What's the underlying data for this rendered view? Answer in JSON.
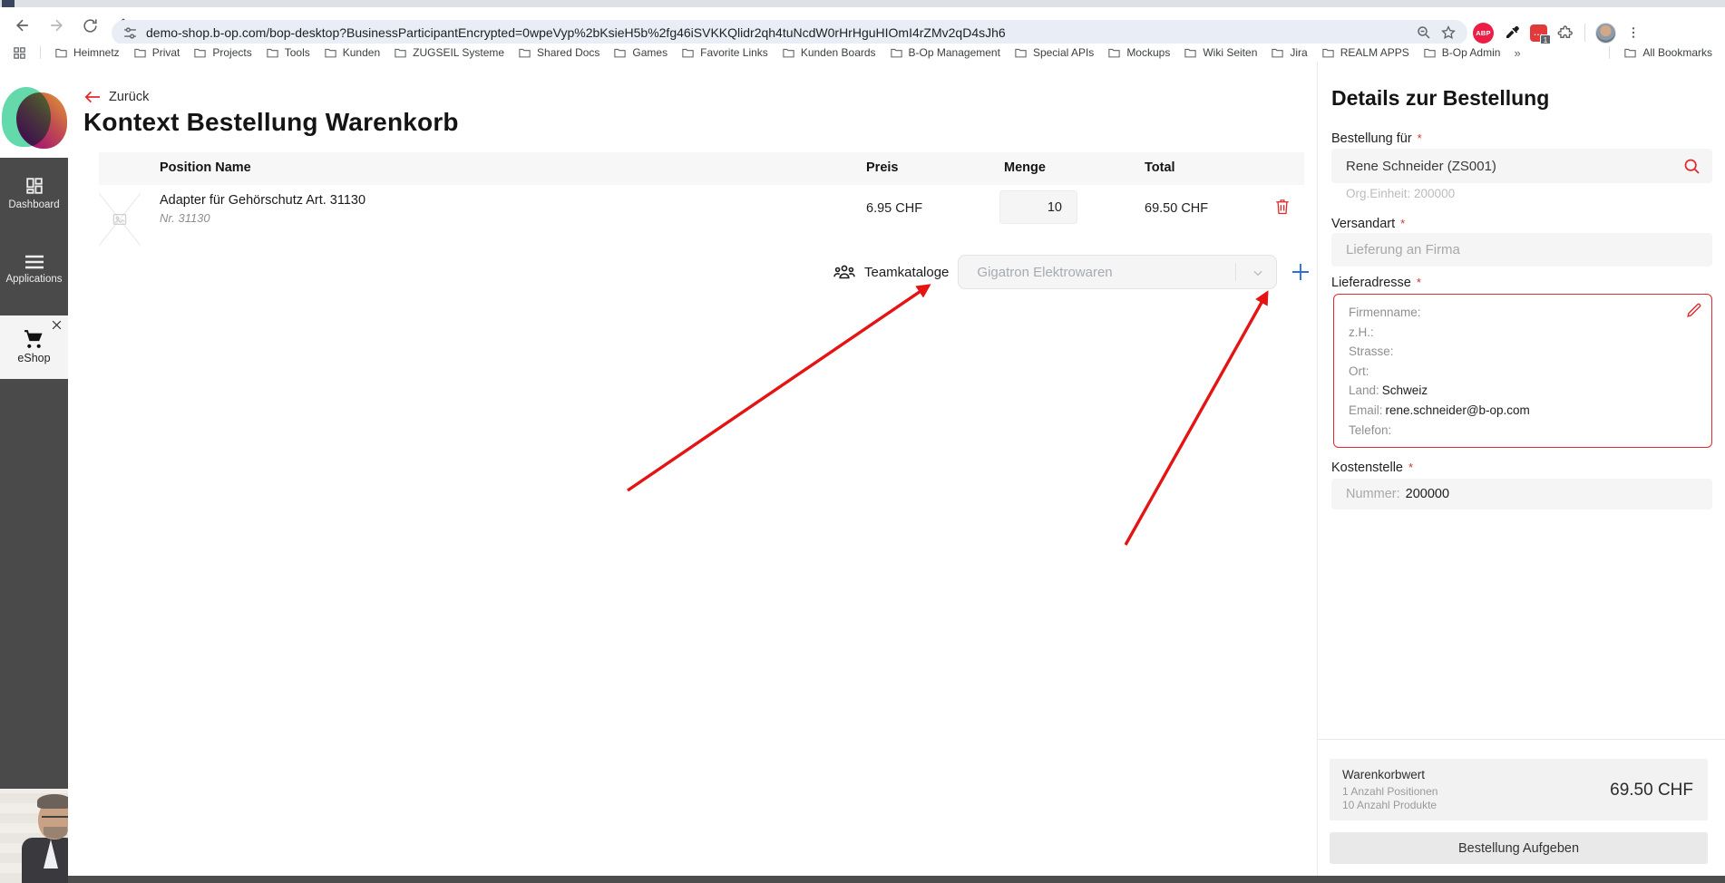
{
  "browser": {
    "url": "demo-shop.b-op.com/bop-desktop?BusinessParticipantEncrypted=0wpeVyp%2bKsieH5b%2fg46iSVKKQlidr2qh4tuNcdW0rHrHguHIOmI4rZMv2qD4sJh6",
    "bookmarks": [
      "Heimnetz",
      "Privat",
      "Projects",
      "Tools",
      "Kunden",
      "ZUGSEIL Systeme",
      "Shared Docs",
      "Games",
      "Favorite Links",
      "Kunden Boards",
      "B-Op Management",
      "Special APIs",
      "Mockups",
      "Wiki Seiten",
      "Jira",
      "REALM APPS",
      "B-Op Admin"
    ],
    "overflow_glyph": "»",
    "all_bookmarks_label": "All Bookmarks",
    "extensions": {
      "abp": "ABP",
      "badge": "1",
      "redext_dots": "..."
    }
  },
  "sidebar": {
    "items": [
      {
        "label": "Dashboard"
      },
      {
        "label": "Applications"
      }
    ],
    "eshop_label": "eShop"
  },
  "main": {
    "back_label": "Zurück",
    "title": "Kontext Bestellung Warenkorb",
    "table": {
      "headers": {
        "position": "Position Name",
        "price": "Preis",
        "qty": "Menge",
        "total": "Total"
      },
      "rows": [
        {
          "name": "Adapter für Gehörschutz Art. 31130",
          "nr": "Nr. 31130",
          "price": "6.95 CHF",
          "qty": "10",
          "total": "69.50 CHF"
        }
      ]
    },
    "team_catalogs": {
      "label": "Teamkataloge",
      "selected": "Gigatron Elektrowaren"
    }
  },
  "details": {
    "title": "Details zur Bestellung",
    "order_for": {
      "label": "Bestellung für",
      "required": "*",
      "value": "Rene Schneider (ZS001)",
      "org": "Org.Einheit: 200000"
    },
    "shipping": {
      "label": "Versandart",
      "required": "*",
      "value": "Lieferung an Firma"
    },
    "address": {
      "label": "Lieferadresse",
      "required": "*",
      "lines": [
        {
          "label": "Firmenname:",
          "value": ""
        },
        {
          "label": "z.H.:",
          "value": ""
        },
        {
          "label": "Strasse:",
          "value": ""
        },
        {
          "label": "Ort:",
          "value": ""
        },
        {
          "label": "Land:",
          "value": "Schweiz"
        },
        {
          "label": "Email:",
          "value": "rene.schneider@b-op.com"
        },
        {
          "label": "Telefon:",
          "value": ""
        }
      ]
    },
    "cost_center": {
      "label": "Kostenstelle",
      "required": "*",
      "prefix": "Nummer:",
      "value": "200000"
    },
    "summary": {
      "title": "Warenkorbwert",
      "positions": "1 Anzahl Positionen",
      "products": "10 Anzahl Produkte",
      "total": "69.50 CHF"
    },
    "submit_label": "Bestellung Aufgeben"
  },
  "icons": {
    "back": "arrow-left",
    "forward": "arrow-right",
    "reload": "circular-arrow",
    "home": "house",
    "tune": "sliders",
    "zoom": "magnifier-minus",
    "star": "star-outline",
    "eyedropper": "pipette",
    "puzzle": "extensions",
    "menu": "three-dots",
    "folder": "bookmark-folder",
    "dashboard": "grid",
    "applications": "hamburger",
    "cart": "shopping-cart",
    "close": "x",
    "trash": "trash-can",
    "groups": "people",
    "plus": "plus",
    "search": "magnifier",
    "pencil": "edit",
    "chevron": "chevron-down"
  },
  "colors": {
    "accent_red": "#df2b2f",
    "arrow_red": "#e51414",
    "plus_blue": "#2e6fe0",
    "sidebar_dark": "#4a4a4a"
  }
}
